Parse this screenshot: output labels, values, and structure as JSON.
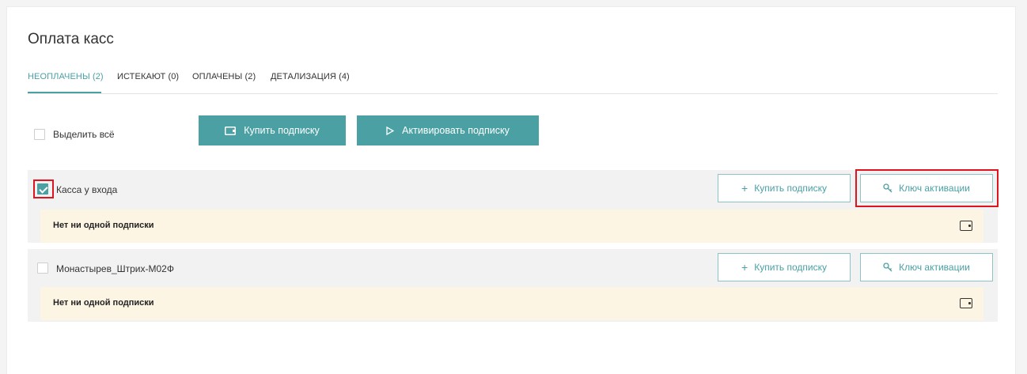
{
  "page": {
    "title": "Оплата касс"
  },
  "tabs": [
    {
      "label": "НЕОПЛАЧЕНЫ (2)",
      "active": true
    },
    {
      "label": "ИСТЕКАЮТ (0)",
      "active": false
    },
    {
      "label": "ОПЛАЧЕНЫ (2)",
      "active": false
    },
    {
      "label": "ДЕТАЛИЗАЦИЯ (4)",
      "active": false
    }
  ],
  "toolbar": {
    "select_all_label": "Выделить всё",
    "select_all_checked": false,
    "buy_label": "Купить подписку",
    "activate_label": "Активировать подписку"
  },
  "registers": [
    {
      "name": "Касса у входа",
      "checked": true,
      "buy_label": "Купить подписку",
      "key_label": "Ключ активации",
      "status": "Нет ни одной подписки"
    },
    {
      "name": "Монастырев_Штрих-М02Ф",
      "checked": false,
      "buy_label": "Купить подписку",
      "key_label": "Ключ активации",
      "status": "Нет ни одной подписки"
    }
  ],
  "colors": {
    "accent": "#4aa0a3",
    "highlight": "#e0141e",
    "status_bg": "#fdf5e4"
  },
  "icons": {
    "buy": "wallet-icon",
    "activate": "play-icon",
    "plus": "plus-icon",
    "key": "key-icon",
    "status": "wallet-icon"
  }
}
